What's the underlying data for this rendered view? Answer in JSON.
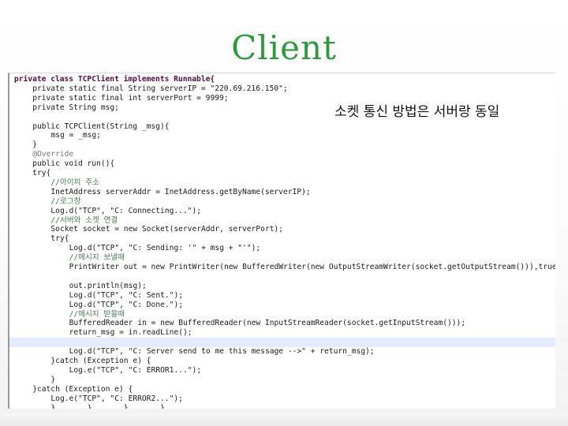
{
  "slide": {
    "title": "Client",
    "note": "소켓 통신 방법은 서버랑 동일"
  },
  "code": [
    {
      "text": "private class TCPClient implements Runnable{",
      "indent": 0,
      "kind": "kw"
    },
    {
      "text": "private static final String serverIP = \"220.69.216.150\";",
      "indent": 4,
      "kind": "code"
    },
    {
      "text": "private static final int serverPort = 9999;",
      "indent": 4,
      "kind": "code"
    },
    {
      "text": "private String msg;",
      "indent": 4,
      "kind": "code"
    },
    {
      "text": "",
      "indent": 0,
      "kind": "code"
    },
    {
      "text": "public TCPClient(String _msg){",
      "indent": 4,
      "kind": "code"
    },
    {
      "text": "msg = _msg;",
      "indent": 8,
      "kind": "code"
    },
    {
      "text": "}",
      "indent": 4,
      "kind": "code"
    },
    {
      "text": "@Override",
      "indent": 4,
      "kind": "annot"
    },
    {
      "text": "public void run(){",
      "indent": 4,
      "kind": "code"
    },
    {
      "text": "try{",
      "indent": 4,
      "kind": "code"
    },
    {
      "text": "//아이피 주소",
      "indent": 8,
      "kind": "comment"
    },
    {
      "text": "InetAddress serverAddr = InetAddress.getByName(serverIP);",
      "indent": 8,
      "kind": "code"
    },
    {
      "text": "//로그창",
      "indent": 8,
      "kind": "comment"
    },
    {
      "text": "Log.d(\"TCP\", \"C: Connecting...\");",
      "indent": 8,
      "kind": "code"
    },
    {
      "text": "//서버와 소켓 연결",
      "indent": 8,
      "kind": "comment"
    },
    {
      "text": "Socket socket = new Socket(serverAddr, serverPort);",
      "indent": 8,
      "kind": "code"
    },
    {
      "text": "try{",
      "indent": 8,
      "kind": "code"
    },
    {
      "text": "Log.d(\"TCP\", \"C: Sending: '\" + msg + \"'\");",
      "indent": 12,
      "kind": "code"
    },
    {
      "text": "//메시지 보낼때",
      "indent": 12,
      "kind": "comment"
    },
    {
      "text": "PrintWriter out = new PrintWriter(new BufferedWriter(new OutputStreamWriter(socket.getOutputStream())),true);",
      "indent": 12,
      "kind": "code"
    },
    {
      "text": "",
      "indent": 0,
      "kind": "code"
    },
    {
      "text": "out.println(msg);",
      "indent": 12,
      "kind": "code"
    },
    {
      "text": "Log.d(\"TCP\", \"C: Sent.\");",
      "indent": 12,
      "kind": "code"
    },
    {
      "text": "Log.d(\"TCP\", \"C: Done.\");",
      "indent": 12,
      "kind": "code"
    },
    {
      "text": "//메시지 받을때",
      "indent": 12,
      "kind": "comment"
    },
    {
      "text": "BufferedReader in = new BufferedReader(new InputStreamReader(socket.getInputStream()));",
      "indent": 12,
      "kind": "code"
    },
    {
      "text": "return_msg = in.readLine();",
      "indent": 12,
      "kind": "code"
    },
    {
      "text": "",
      "indent": 0,
      "kind": "hl"
    },
    {
      "text": "Log.d(\"TCP\", \"C: Server send to me this message -->\" + return_msg);",
      "indent": 12,
      "kind": "code"
    },
    {
      "text": "}catch (Exception e) {",
      "indent": 8,
      "kind": "code"
    },
    {
      "text": "Log.e(\"TCP\", \"C: ERROR1...\");",
      "indent": 12,
      "kind": "code"
    },
    {
      "text": "}",
      "indent": 8,
      "kind": "code"
    },
    {
      "text": "}catch (Exception e) {",
      "indent": 4,
      "kind": "code"
    },
    {
      "text": "Log.e(\"TCP\", \"C: ERROR2...\");",
      "indent": 8,
      "kind": "code"
    },
    {
      "text": "}       }       }       }",
      "indent": 8,
      "kind": "code"
    }
  ]
}
